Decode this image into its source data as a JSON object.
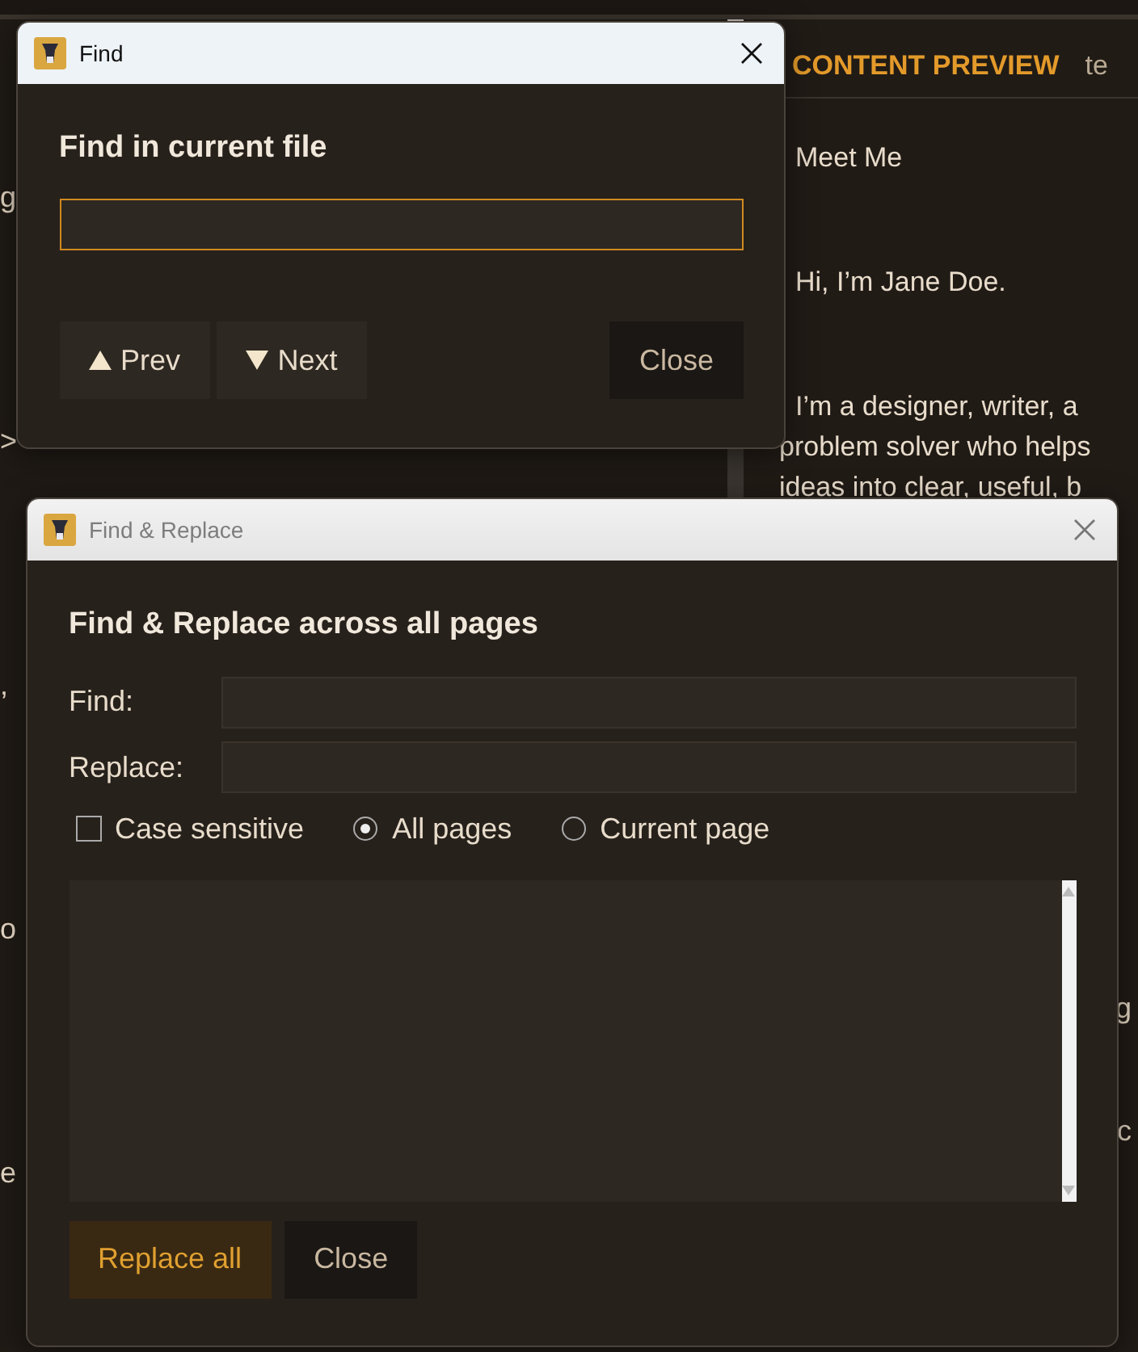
{
  "background": {
    "left_fragments": [
      "g",
      ">",
      ",",
      "o",
      "e"
    ],
    "preview": {
      "title": "CONTENT PREVIEW",
      "tab": "te",
      "paragraphs": [
        [
          "Meet Me"
        ],
        [
          "Hi, I’m Jane Doe."
        ],
        [
          "I’m a designer, writer, a",
          "problem solver who helps",
          "ideas into clear, useful, b"
        ]
      ],
      "right_fragments": [
        "g",
        "c"
      ]
    }
  },
  "find_dialog": {
    "title": "Find",
    "active": true,
    "heading": "Find in current file",
    "field": {
      "focused": true
    },
    "buttons": [
      {
        "label": "Prev",
        "kind": "prev"
      },
      {
        "label": "Next",
        "kind": "next"
      },
      {
        "label": "Close",
        "kind": "close"
      }
    ]
  },
  "replace_dialog": {
    "title": "Find & Replace",
    "active": false,
    "heading": "Find & Replace across all pages",
    "fields": [
      {
        "label": "Find:"
      },
      {
        "label": "Replace:"
      }
    ],
    "options": [
      {
        "kind": "checkbox",
        "label": "Case sensitive",
        "checked": false
      },
      {
        "kind": "radio",
        "label": "All pages",
        "selected": true
      },
      {
        "kind": "radio",
        "label": "Current page",
        "selected": false
      }
    ],
    "buttons": [
      {
        "label": "Replace all",
        "kind": "primary"
      },
      {
        "label": "Close",
        "kind": "close"
      }
    ]
  }
}
